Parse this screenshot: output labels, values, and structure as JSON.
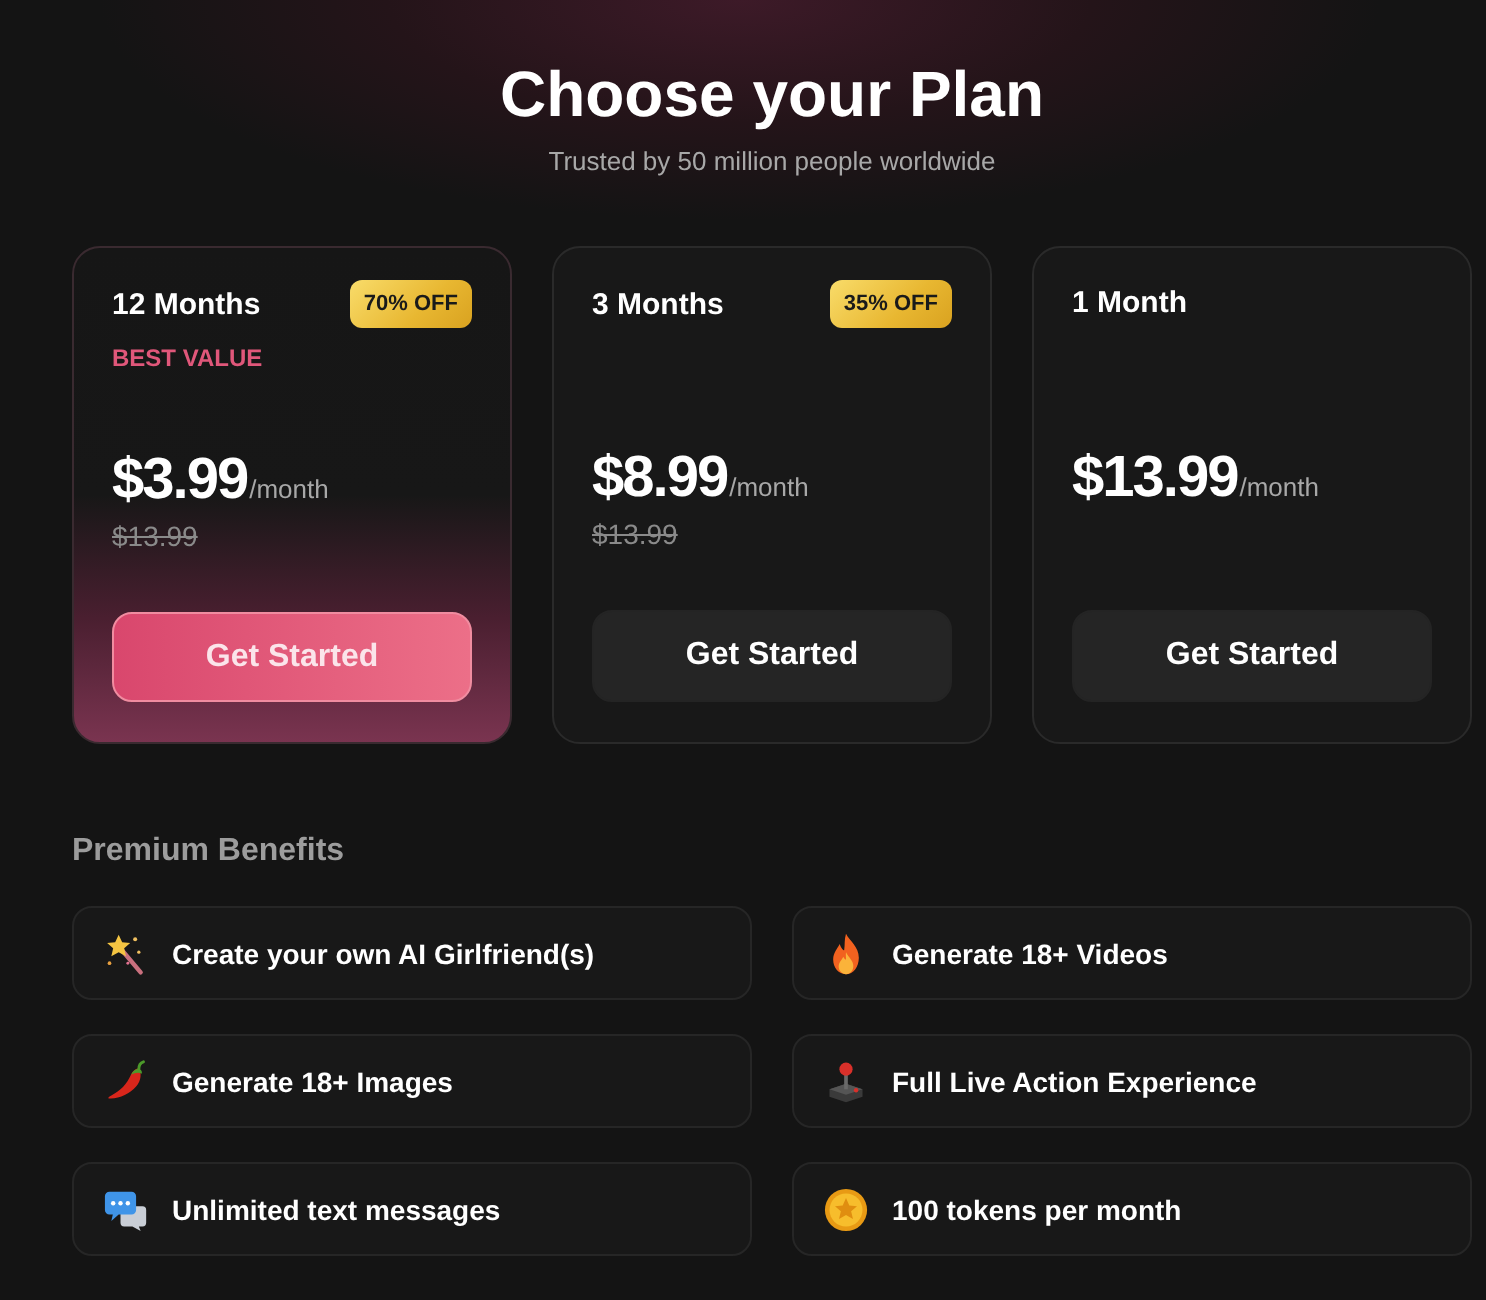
{
  "header": {
    "title": "Choose your Plan",
    "subtitle": "Trusted by 50 million people worldwide"
  },
  "plans": [
    {
      "duration": "12 Months",
      "badge": "70% OFF",
      "tag": "BEST VALUE",
      "price": "$3.99",
      "period": "/month",
      "old_price": "$13.99",
      "button": "Get Started",
      "selected": true
    },
    {
      "duration": "3 Months",
      "badge": "35% OFF",
      "price": "$8.99",
      "period": "/month",
      "old_price": "$13.99",
      "button": "Get Started",
      "selected": false
    },
    {
      "duration": "1 Month",
      "price": "$13.99",
      "period": "/month",
      "button": "Get Started",
      "selected": false
    }
  ],
  "benefits": {
    "heading": "Premium Benefits",
    "items": [
      "Create your own AI Girlfriend(s)",
      "Generate 18+ Videos",
      "Generate 18+ Images",
      "Full Live Action Experience",
      "Unlimited text messages",
      "100 tokens per month"
    ]
  }
}
